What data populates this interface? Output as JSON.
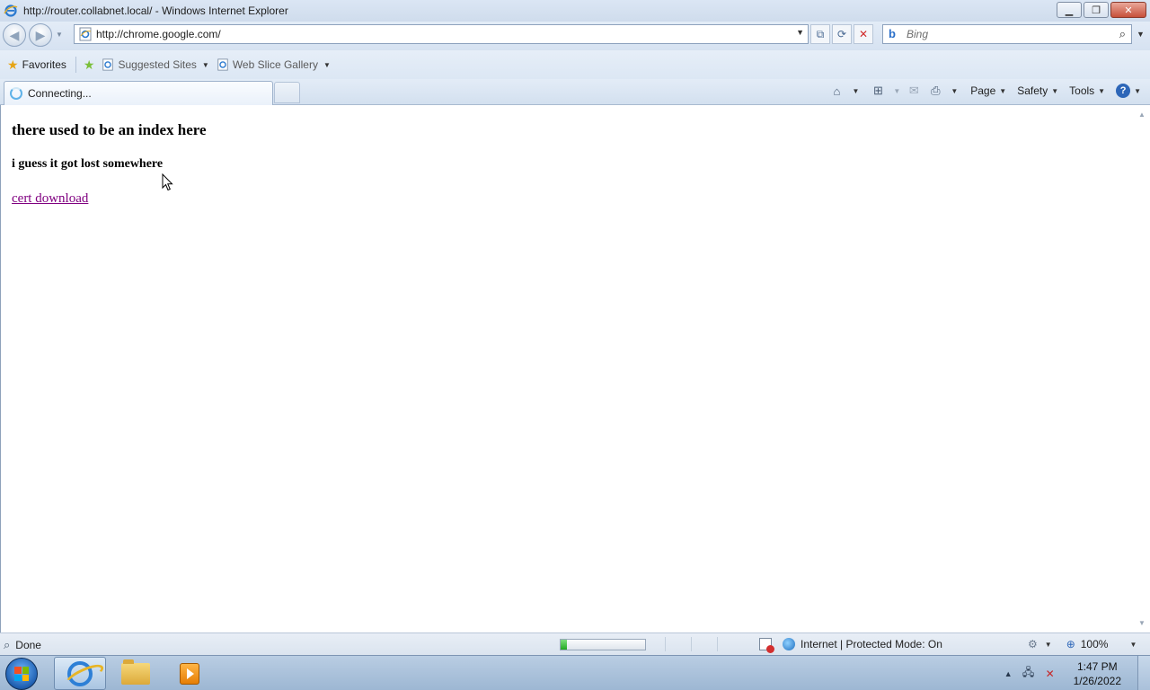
{
  "window": {
    "title": "http://router.collabnet.local/ - Windows Internet Explorer"
  },
  "address": {
    "url": "http://chrome.google.com/"
  },
  "search": {
    "placeholder": "Bing"
  },
  "favorites_bar": {
    "favorites_label": "Favorites",
    "items": [
      {
        "label": "Suggested Sites"
      },
      {
        "label": "Web Slice Gallery"
      }
    ]
  },
  "tab": {
    "label": "Connecting..."
  },
  "commands": {
    "page": "Page",
    "safety": "Safety",
    "tools": "Tools"
  },
  "page": {
    "heading": "there used to be an index here",
    "subheading": "i guess it got lost somewhere",
    "link": "cert download"
  },
  "status": {
    "text": "Done",
    "zone": "Internet | Protected Mode: On",
    "zoom": "100%",
    "progress": 0.07
  },
  "clock": {
    "time": "1:47 PM",
    "date": "1/26/2022"
  }
}
